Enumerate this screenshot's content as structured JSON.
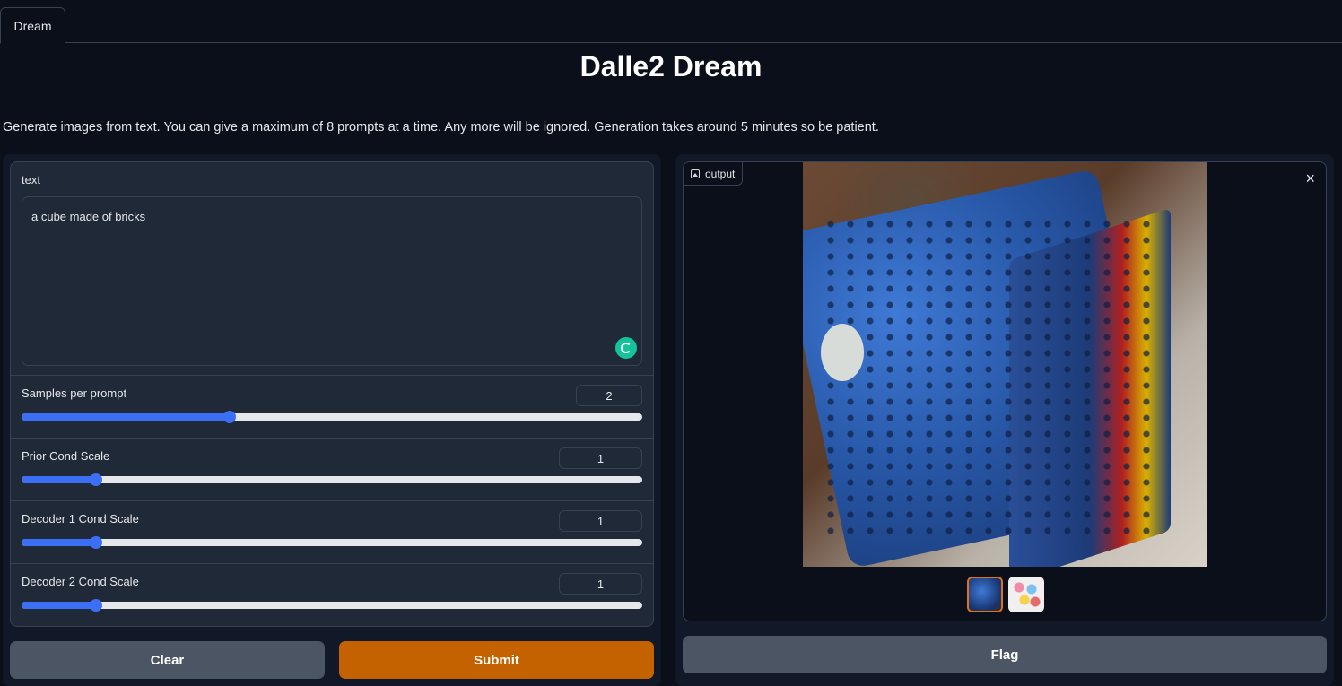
{
  "tabs": [
    {
      "label": "Dream"
    }
  ],
  "header": {
    "title": "Dalle2 Dream",
    "description": "Generate images from text. You can give a maximum of 8 prompts at a time. Any more will be ignored. Generation takes around 5 minutes so be patient."
  },
  "form": {
    "text": {
      "label": "text",
      "value": "a cube made of bricks"
    },
    "sliders": [
      {
        "label": "Samples per prompt",
        "value": "2",
        "fraction": 0.335
      },
      {
        "label": "Prior Cond Scale",
        "value": "1",
        "fraction": 0.12
      },
      {
        "label": "Decoder 1 Cond Scale",
        "value": "1",
        "fraction": 0.12
      },
      {
        "label": "Decoder 2 Cond Scale",
        "value": "1",
        "fraction": 0.12
      }
    ],
    "buttons": {
      "clear": "Clear",
      "submit": "Submit"
    }
  },
  "output": {
    "label": "output",
    "close_icon": "×",
    "thumbnails": [
      {
        "name": "blue brick cube",
        "selected": true
      },
      {
        "name": "colorful bricks",
        "selected": false
      }
    ],
    "flag": "Flag"
  },
  "colors": {
    "accent": "#3b6ff5",
    "submit": "#c46200",
    "background": "#0b0f19"
  }
}
